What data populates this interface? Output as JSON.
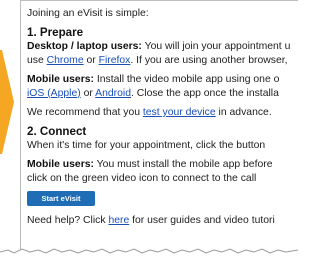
{
  "intro": "Joining an eVisit is simple:",
  "prepare": {
    "heading": "1. Prepare",
    "desktop_label": "Desktop / laptop users:",
    "desktop_text": " You will join your appointment u",
    "use_text": "use ",
    "chrome_link": "Chrome",
    "or_text_1": " or ",
    "firefox_link": "Firefox",
    "browser_text": ". If you are using another browser,",
    "mobile_label": "Mobile users:",
    "mobile_text": " Install the video mobile app using one o",
    "ios_link": "iOS (Apple)",
    "or_text_2": " or ",
    "android_link": "Android",
    "close_text": ". Close the app once the installa",
    "recommend_text": "We recommend that you ",
    "test_link": "test your device",
    "advance_text": " in advance."
  },
  "connect": {
    "heading": "2. Connect",
    "when_text": "When it's time for your appointment, click the button",
    "mobile_label": "Mobile users:",
    "mobile_text": " You must install the mobile app before",
    "green_icon_text": "click on the green video icon to connect to the call",
    "button_label": "Start eVisit"
  },
  "help": {
    "need_text": "Need help? Click ",
    "here_link": "here",
    "guides_text": " for user guides and video tutori"
  },
  "colors": {
    "arrow": "#f5a623",
    "link": "#1a4fb8",
    "button": "#1f6db5"
  }
}
